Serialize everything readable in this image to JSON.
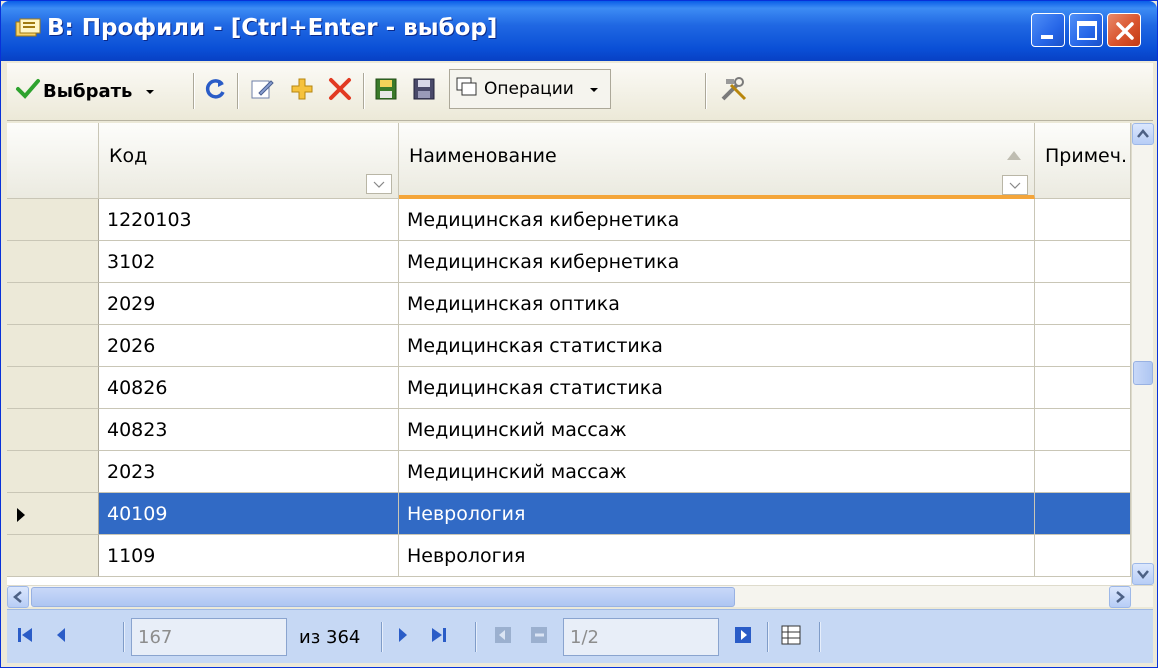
{
  "window": {
    "title": "В: Профили - [Ctrl+Enter - выбор]"
  },
  "toolbar": {
    "select_label": "Выбрать",
    "operations_label": "Операции"
  },
  "grid": {
    "columns": [
      {
        "label": "Код"
      },
      {
        "label": "Наименование"
      },
      {
        "label": "Примеч."
      }
    ],
    "rows": [
      {
        "code": "1220103",
        "name": "Медицинская кибернетика",
        "note": ""
      },
      {
        "code": "3102",
        "name": "Медицинская кибернетика",
        "note": ""
      },
      {
        "code": "2029",
        "name": "Медицинская оптика",
        "note": ""
      },
      {
        "code": "2026",
        "name": "Медицинская статистика",
        "note": ""
      },
      {
        "code": "40826",
        "name": "Медицинская статистика",
        "note": ""
      },
      {
        "code": "40823",
        "name": "Медицинский массаж",
        "note": ""
      },
      {
        "code": "2023",
        "name": "Медицинский массаж",
        "note": ""
      },
      {
        "code": "40109",
        "name": "Неврология",
        "note": ""
      },
      {
        "code": "1109",
        "name": "Неврология",
        "note": ""
      }
    ],
    "selected_row": 7
  },
  "navigator": {
    "current_record": "167",
    "total_label": "из 364",
    "page_value": "1/2"
  },
  "colors": {
    "selection": "#316ac5",
    "sort_underline": "#f4a53a",
    "titlebar": "#0a4fd6"
  }
}
